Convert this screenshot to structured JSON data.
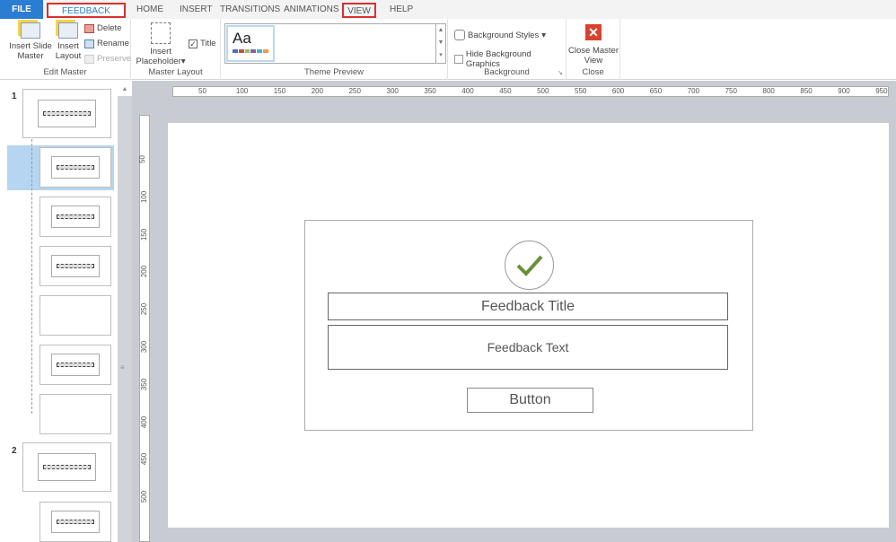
{
  "tabs": [
    "FILE",
    "FEEDBACK MASTER",
    "HOME",
    "INSERT",
    "TRANSITIONS",
    "ANIMATIONS",
    "VIEW",
    "HELP"
  ],
  "ribbon": {
    "edit_master": {
      "label": "Edit Master",
      "insert_slide_master": "Insert Slide Master",
      "insert_layout": "Insert Layout",
      "delete": "Delete",
      "rename": "Rename",
      "preserve": "Preserve"
    },
    "master_layout": {
      "label": "Master Layout",
      "insert_placeholder": "Insert Placeholder",
      "title": "Title",
      "title_checked": true
    },
    "theme_preview": {
      "label": "Theme Preview",
      "sample": "Aa",
      "swatches": [
        "#4472c4",
        "#c0504d",
        "#9bbb59",
        "#8064a2",
        "#4bacc6",
        "#f79646"
      ]
    },
    "background": {
      "label": "Background",
      "styles": "Background Styles",
      "hide": "Hide Background Graphics",
      "hide_checked": false
    },
    "close": {
      "label": "Close",
      "close_master_view": "Close Master View",
      "color": "#d9432c"
    }
  },
  "panel": {
    "group1": "1",
    "group2": "2"
  },
  "ruler": {
    "h": [
      "50",
      "100",
      "150",
      "200",
      "250",
      "300",
      "350",
      "400",
      "450",
      "500",
      "550",
      "600",
      "650",
      "700",
      "750",
      "800",
      "850",
      "900",
      "950"
    ],
    "v": [
      "50",
      "100",
      "150",
      "200",
      "250",
      "300",
      "350",
      "400",
      "450",
      "500"
    ]
  },
  "slide": {
    "title": "Feedback Title",
    "text": "Feedback Text",
    "button": "Button",
    "check_color": "#6a8f3a"
  }
}
